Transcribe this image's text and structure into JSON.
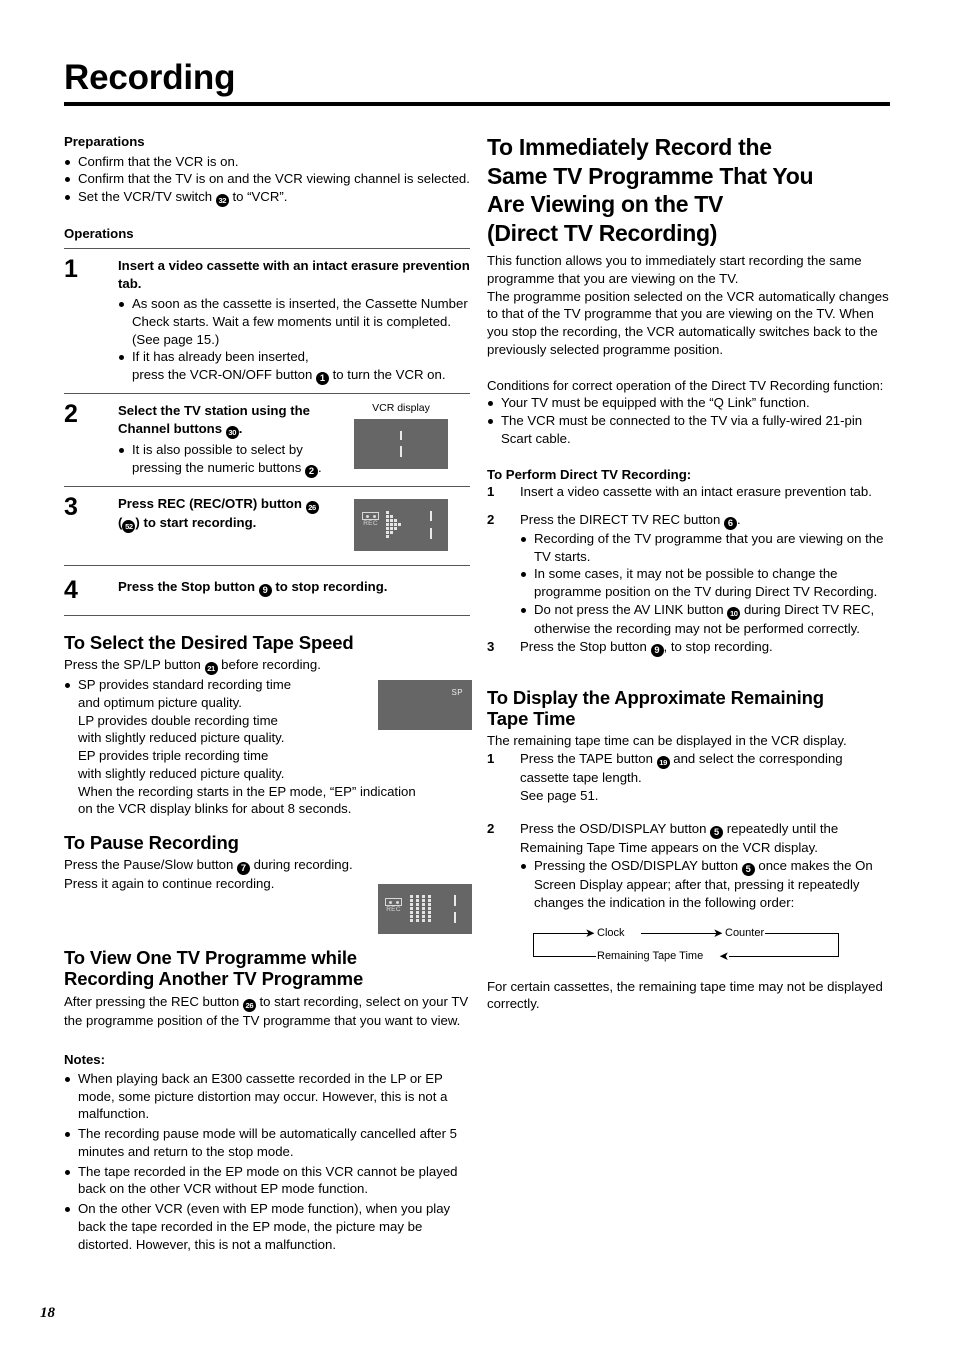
{
  "page": {
    "title": "Recording",
    "number": "18"
  },
  "left": {
    "preparations": {
      "heading": "Preparations",
      "items": [
        "Confirm that the VCR is on.",
        "Confirm that the TV is on and the VCR viewing channel is selected.",
        "Set the VCR/TV switch ➋ to “VCR”."
      ],
      "switch_ref": "32"
    },
    "operations": {
      "heading": "Operations",
      "steps": [
        {
          "num": "1",
          "head": "Insert a video cassette with an intact erasure prevention tab.",
          "bullets": [
            "As soon as the cassette is inserted, the Cassette Number Check starts. Wait a few moments until it is completed. (See page 15.)",
            "If it has already been inserted, press the VCR-ON/OFF button ① to turn the VCR on."
          ],
          "bullet_refs": [
            "",
            "1"
          ]
        },
        {
          "num": "2",
          "head": "Select the TV station using the Channel buttons ⑩.",
          "head_ref": "30",
          "bullets": [
            "It is also possible to select by pressing the numeric buttons ②."
          ],
          "bullet_refs": [
            "2"
          ],
          "display_caption": "VCR display"
        },
        {
          "num": "3",
          "head": "Press REC (REC/OTR) button ㉑ (㉖) to start recording.",
          "head_refs": [
            "26",
            "52"
          ]
        },
        {
          "num": "4",
          "head": "Press the Stop button ⑨ to stop recording.",
          "head_ref": "9"
        }
      ]
    },
    "tape_speed": {
      "heading": "To Select the Desired Tape Speed",
      "intro": "Press the SP/LP button ㉐ before recording.",
      "intro_ref": "21",
      "bullet": "SP provides standard recording time and optimum picture quality.\nLP provides double recording time with slightly reduced picture quality.\nEP provides triple recording time with slightly reduced picture quality.\nWhen the recording starts in the EP mode, “EP” indication on the VCR display blinks for about 8 seconds.",
      "bullet_lines": [
        "SP provides standard recording time",
        "and optimum picture quality.",
        "LP provides double recording time",
        "with slightly reduced picture quality.",
        "EP provides triple recording time",
        "with slightly reduced picture quality.",
        "When the recording starts in the EP mode, “EP” indication",
        "on the VCR display blinks for about 8 seconds."
      ],
      "display_label": "SP"
    },
    "pause": {
      "heading": "To Pause Recording",
      "line1": "Press the Pause/Slow button ⑦ during recording.",
      "line1_ref": "7",
      "line2": "Press it again to continue recording."
    },
    "view_one": {
      "heading_line1": "To View One TV Programme while",
      "heading_line2": "Recording Another TV Programme",
      "body": "After pressing the REC button ㉑ to start recording, select on your TV the programme position of the TV programme that you want to view.",
      "body_ref": "26"
    },
    "notes": {
      "heading": "Notes:",
      "items": [
        "When playing back an E300 cassette recorded in the LP or EP mode, some picture distortion may occur. However, this is not a malfunction.",
        "The recording pause mode will be automatically cancelled after 5 minutes and return to the stop mode.",
        "The tape recorded in the EP mode on this VCR cannot be played back on the other VCR without EP mode function.",
        "On the other VCR (even with EP mode function), when you play back the tape recorded in the EP mode, the picture may be distorted. However, this is not a malfunction."
      ]
    }
  },
  "right": {
    "direct_tv": {
      "heading_lines": [
        "To Immediately Record the",
        "Same TV Programme That You",
        "Are Viewing on the TV",
        "(Direct TV Recording)"
      ],
      "intro": "This function allows you to immediately start recording the same programme that you are viewing on the TV.\nThe programme position selected on the VCR automatically changes to that of the TV programme that you are viewing on the TV. When you stop the recording, the VCR automatically switches back to the previously selected programme position.",
      "intro_p1": "This function allows you to immediately start recording the same programme that you are viewing on the TV.",
      "intro_p2": "The programme position selected on the VCR automatically changes to that of the TV programme that you are viewing on the TV. When you stop the recording, the VCR automatically switches back to the previously selected programme position.",
      "conditions_intro": "Conditions for correct operation of the Direct TV Recording function:",
      "conditions": [
        "Your TV must be equipped with the “Q Link” function.",
        "The VCR must be connected to the TV via a fully-wired 21-pin Scart cable."
      ],
      "perform_heading": "To Perform Direct TV Recording:",
      "steps": [
        {
          "num": "1",
          "text": "Insert a video cassette with an intact erasure prevention tab."
        },
        {
          "num": "2",
          "text": "Press the DIRECT TV REC button ⑥.",
          "ref": "6",
          "bullets": [
            "Recording of the TV programme that you are viewing on the TV starts.",
            "In some cases, it may not be possible to change the programme position on the TV during Direct TV Recording.",
            "Do not press the AV LINK button ⑩ during Direct TV REC, otherwise the recording may not be performed correctly."
          ],
          "bullet_refs": [
            "",
            "",
            "10"
          ]
        },
        {
          "num": "3",
          "text": "Press the Stop button ⑨, to stop recording.",
          "ref": "9"
        }
      ]
    },
    "remaining_time": {
      "heading_line1": "To Display the Approximate Remaining",
      "heading_line2": "Tape Time",
      "intro": "The remaining tape time can be displayed in the VCR display.",
      "steps": [
        {
          "num": "1",
          "text": "Press the TAPE button ⑲ and select the corresponding cassette tape length.",
          "ref": "19",
          "extra": "See page 51."
        },
        {
          "num": "2",
          "text": "Press the OSD/DISPLAY button ⑤ repeatedly until the Remaining Tape Time appears on the VCR display.",
          "ref": "5",
          "bullets": [
            "Pressing the OSD/DISPLAY button ⑤ once makes the On Screen Display appear; after that, pressing it repeatedly changes the indication in the following order:"
          ],
          "bullet_refs": [
            "5"
          ]
        }
      ],
      "cycle": {
        "item1": "Clock",
        "item2": "Counter",
        "item3": "Remaining Tape Time"
      },
      "footer": "For certain cassettes, the remaining tape time may not be displayed correctly."
    }
  },
  "colors": {
    "vcr_display_bg": "#666666",
    "vcr_display_fg": "#e4e4e4",
    "rule": "#555555",
    "text": "#000000"
  }
}
